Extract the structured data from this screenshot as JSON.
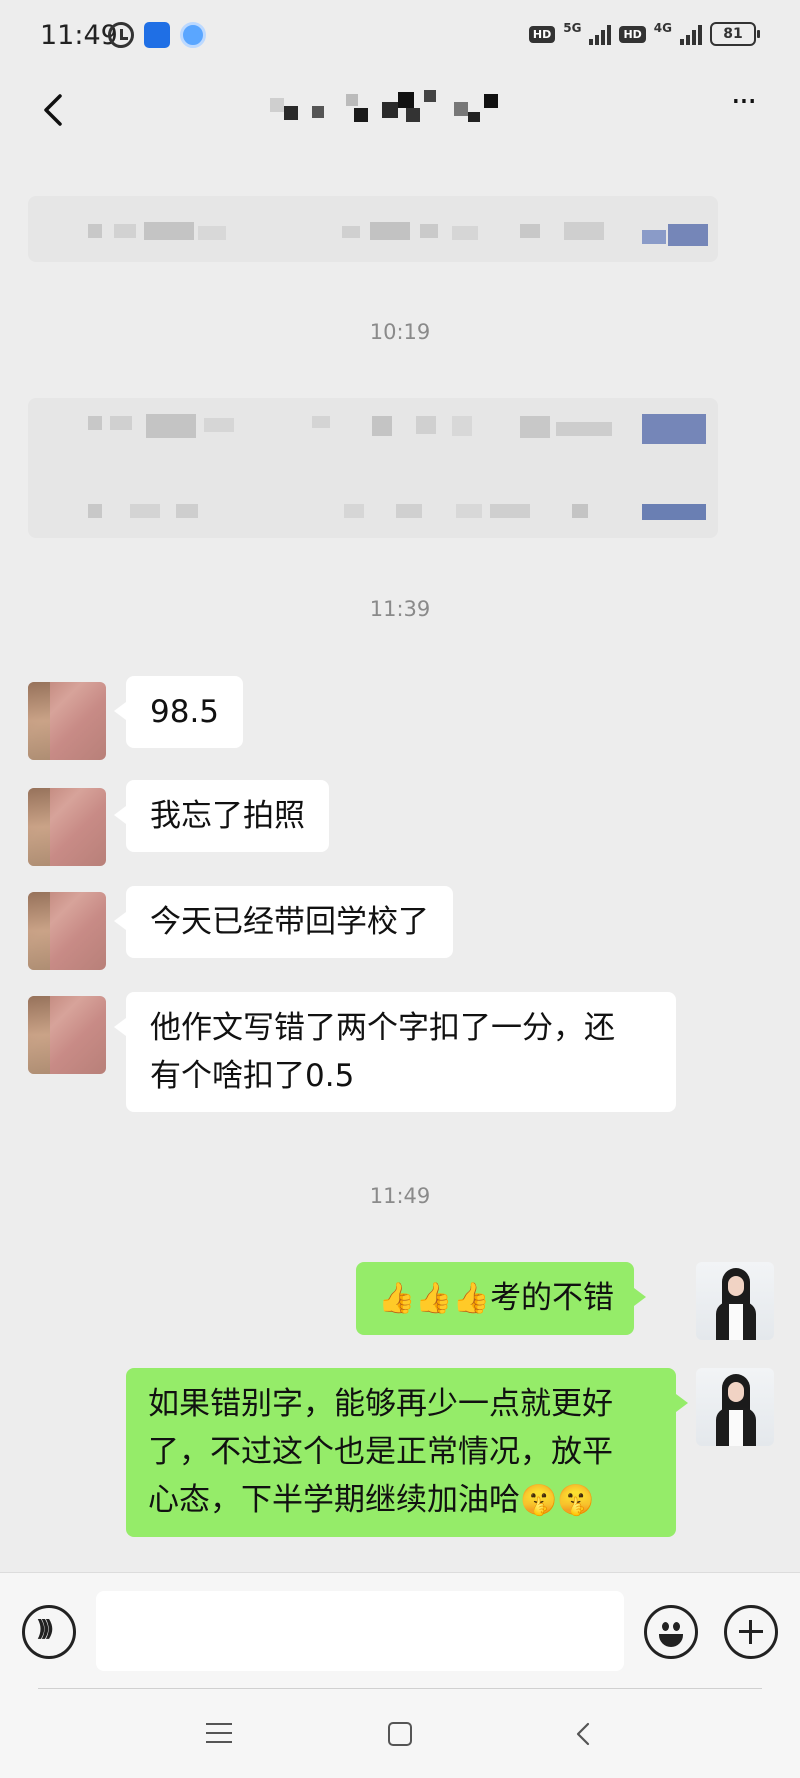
{
  "status_bar": {
    "time": "11:49",
    "network_1": "5G",
    "network_2": "4G",
    "hd_1": "HD",
    "hd_2": "HD",
    "battery": "81"
  },
  "icons": {
    "back": "chevron-left-icon",
    "more": "more-icon",
    "voice": "voice-icon",
    "emoji": "emoji-icon",
    "plus": "plus-icon"
  },
  "nav": {
    "more": "···"
  },
  "timestamps": {
    "t1": "10:19",
    "t2": "11:39",
    "t3": "11:49"
  },
  "messages": {
    "m1": "98.5",
    "m2": "我忘了拍照",
    "m3": "今天已经带回学校了",
    "m4_line1": "他作文写错了两个字扣了一分，还",
    "m4_line2": "有个啥扣了0.5",
    "m5_emoji": "👍👍👍",
    "m5_text": "考的不错",
    "m6_line1": "如果错别字，能够再少一点就更好",
    "m6_line2": "了，不过这个也是正常情况，放平",
    "m6_line3": "心态，下半学期继续加油哈",
    "m6_emoji": "🤫🤫"
  },
  "input": {
    "placeholder": ""
  },
  "colors": {
    "background": "#ededed",
    "bubble_in": "#ffffff",
    "bubble_out": "#95ec69"
  }
}
